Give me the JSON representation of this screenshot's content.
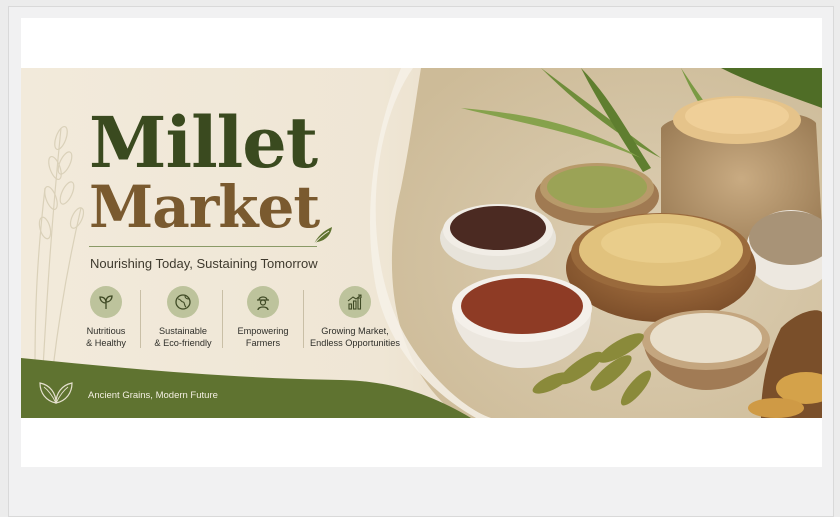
{
  "banner": {
    "title_line1": "Millet",
    "title_line2": "Market",
    "tagline": "Nourishing Today, Sustaining Tomorrow",
    "features": [
      {
        "icon": "sprout-icon",
        "label_line1": "Nutritious",
        "label_line2": "& Healthy"
      },
      {
        "icon": "globe-icon",
        "label_line1": "Sustainable",
        "label_line2": "& Eco-friendly"
      },
      {
        "icon": "farmer-icon",
        "label_line1": "Empowering",
        "label_line2": "Farmers"
      },
      {
        "icon": "growth-chart-icon",
        "label_line1": "Growing Market,",
        "label_line2": "Endless Opportunities"
      }
    ],
    "footer_text": "Ancient Grains, Modern Future",
    "colors": {
      "olive_dark": "#3a4a1f",
      "brown": "#7a5a2f",
      "footer_green": "#5f7330",
      "icon_circle": "#bdc39c",
      "cream": "#f2eadb"
    }
  }
}
